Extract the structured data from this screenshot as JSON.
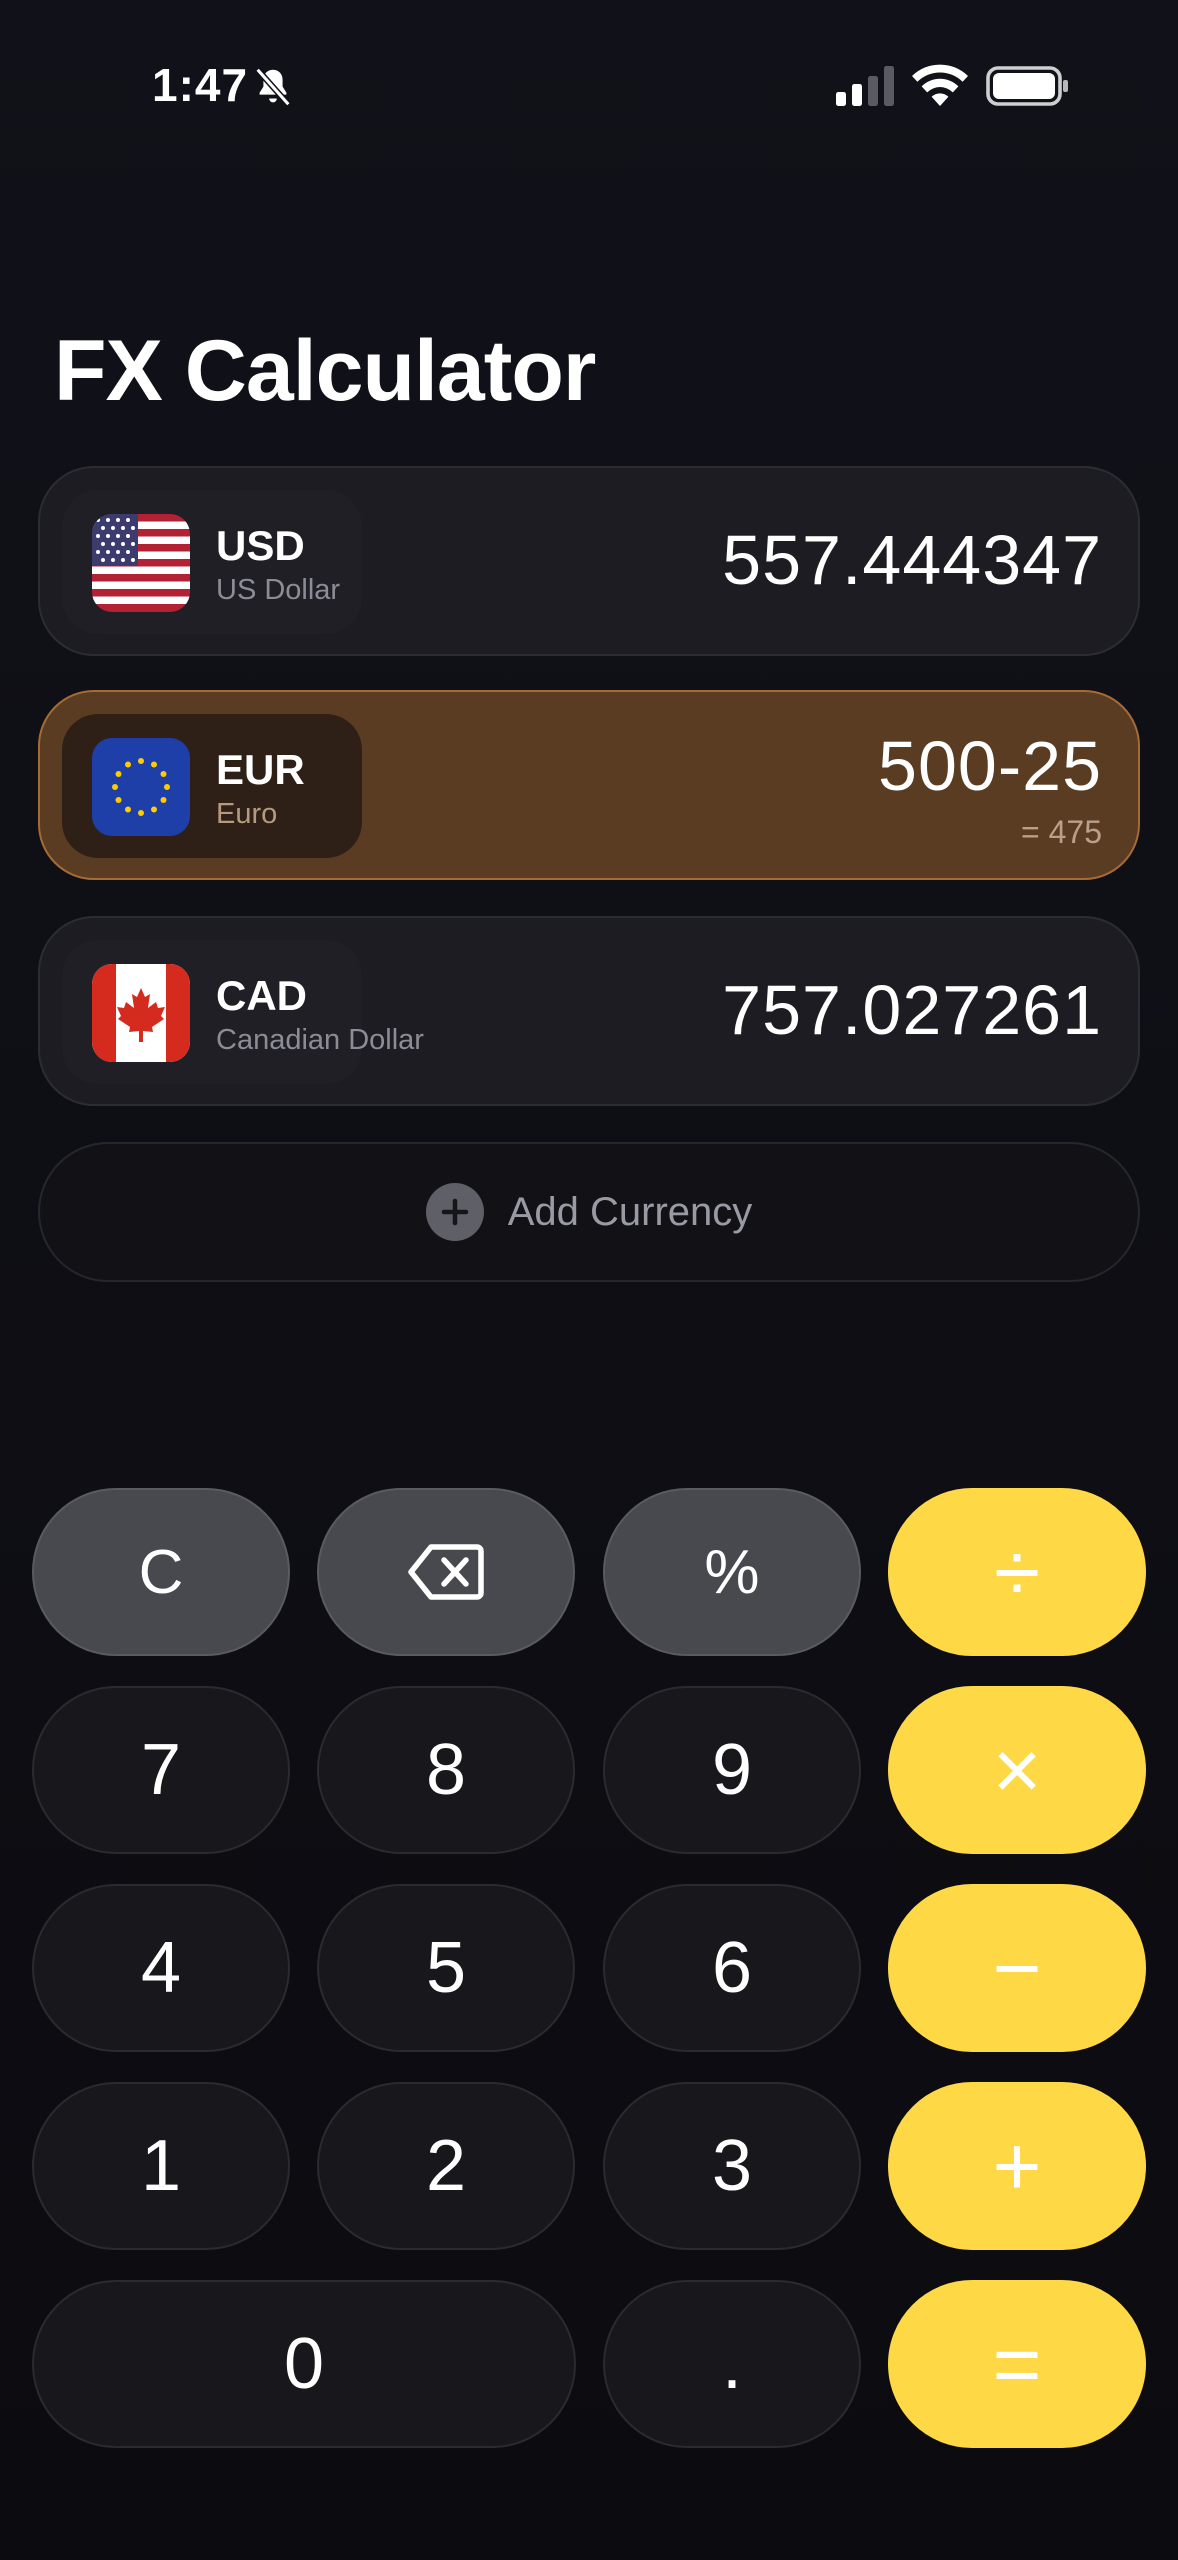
{
  "status_bar": {
    "time": "1:47"
  },
  "title": "FX Calculator",
  "currencies": [
    {
      "code": "USD",
      "name": "US Dollar",
      "value": "557.444347",
      "flag": "us-flag-icon"
    },
    {
      "code": "EUR",
      "name": "Euro",
      "value": "500-25",
      "result": "= 475",
      "flag": "eu-flag-icon",
      "active": true
    },
    {
      "code": "CAD",
      "name": "Canadian Dollar",
      "value": "757.027261",
      "flag": "ca-flag-icon"
    }
  ],
  "add_currency": {
    "label": "Add Currency"
  },
  "keypad": {
    "clear": "C",
    "backspace": "backspace-icon",
    "percent": "%",
    "divide": "÷",
    "multiply": "×",
    "minus": "−",
    "plus": "+",
    "equals": "=",
    "digits": [
      "0",
      "1",
      "2",
      "3",
      "4",
      "5",
      "6",
      "7",
      "8",
      "9"
    ],
    "decimal": "."
  },
  "colors": {
    "background": "#0c0c12",
    "row": "#1c1c22",
    "active_row": "#5a3c22",
    "active_border": "#a66b35",
    "operator": "#ffd945",
    "function_key": "#48484f"
  }
}
